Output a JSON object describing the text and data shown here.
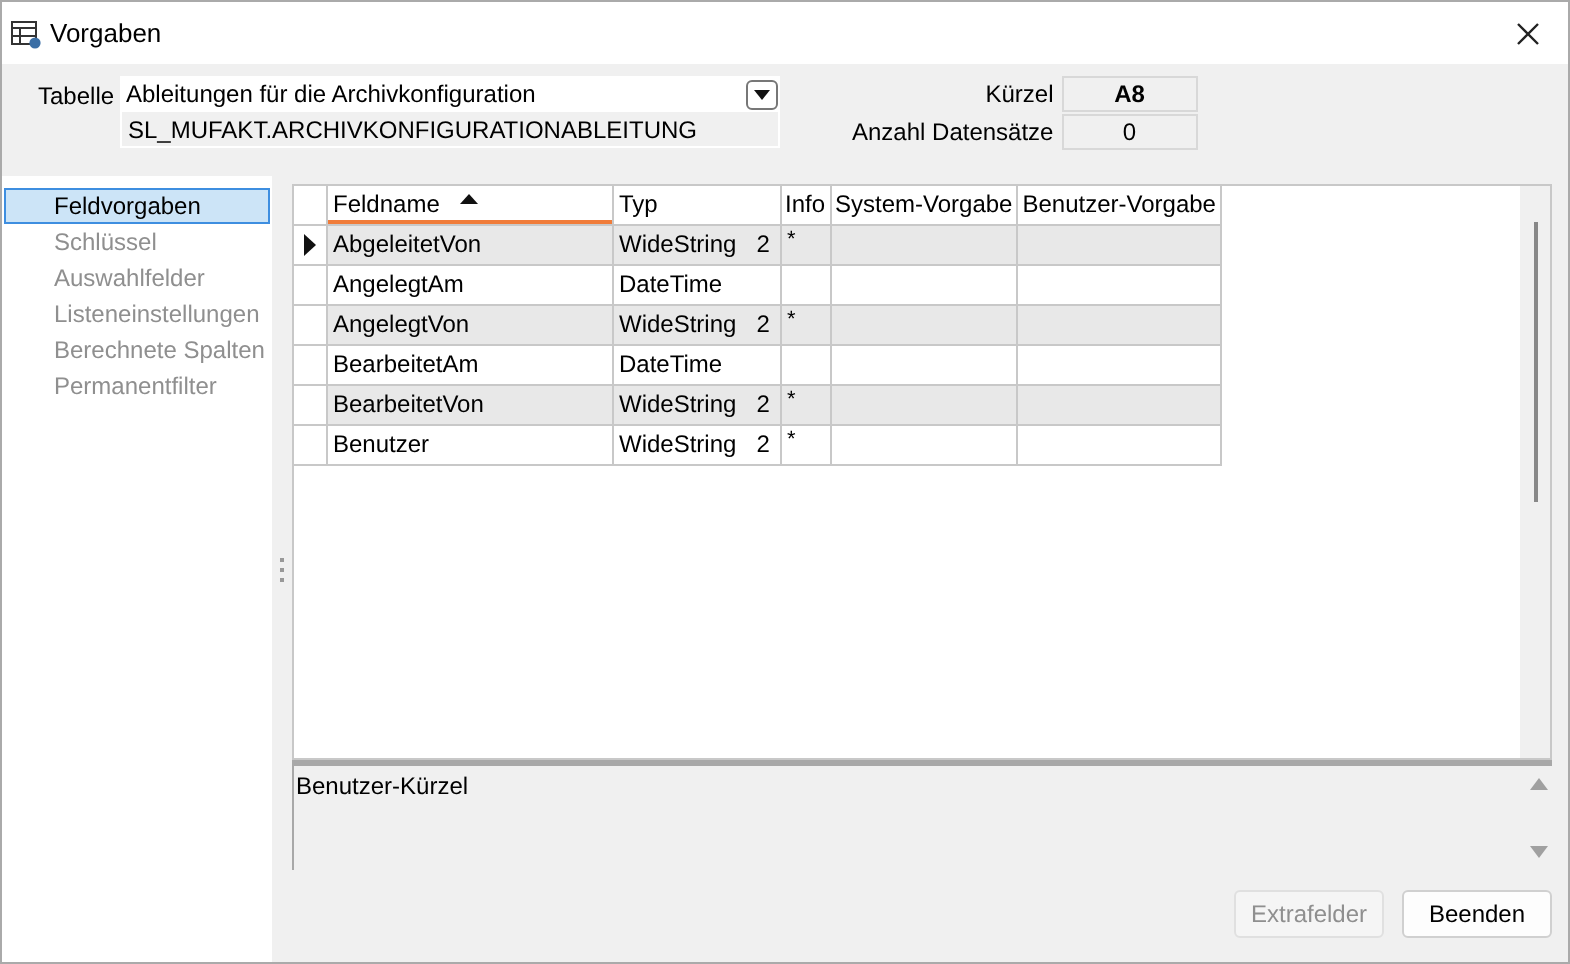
{
  "window": {
    "title": "Vorgaben"
  },
  "tabelle": {
    "label": "Tabelle",
    "value": "Ableitungen für die Archivkonfiguration",
    "internal_name": "SL_MUFAKT.ARCHIVKONFIGURATIONABLEITUNG"
  },
  "info_fields": [
    {
      "label": "Kürzel",
      "value": "A8",
      "bold": true
    },
    {
      "label": "Anzahl Datensätze",
      "value": "0",
      "bold": false
    }
  ],
  "sidebar": {
    "items": [
      {
        "label": "Feldvorgaben",
        "selected": true,
        "disabled": false
      },
      {
        "label": "Schlüssel",
        "selected": false,
        "disabled": true
      },
      {
        "label": "Auswahlfelder",
        "selected": false,
        "disabled": true
      },
      {
        "label": "Listeneinstellungen",
        "selected": false,
        "disabled": true
      },
      {
        "label": "Berechnete Spalten",
        "selected": false,
        "disabled": true
      },
      {
        "label": "Permanentfilter",
        "selected": false,
        "disabled": true
      }
    ]
  },
  "table": {
    "columns": [
      {
        "label": "Feldname",
        "sorted": true
      },
      {
        "label": "Typ",
        "sorted": false
      },
      {
        "label": "Info",
        "sorted": false
      },
      {
        "label": "System-Vorgabe",
        "sorted": false
      },
      {
        "label": "Benutzer-Vorgabe",
        "sorted": false
      }
    ],
    "rows": [
      {
        "current": true,
        "feldname": "AbgeleitetVon",
        "typ": "WideString",
        "length": "2",
        "info": "*"
      },
      {
        "current": false,
        "feldname": "AngelegtAm",
        "typ": "DateTime"
      },
      {
        "current": false,
        "feldname": "AngelegtVon",
        "typ": "WideString",
        "length": "2",
        "info": "*"
      },
      {
        "current": false,
        "feldname": "BearbeitetAm",
        "typ": "DateTime"
      },
      {
        "current": false,
        "feldname": "BearbeitetVon",
        "typ": "WideString",
        "length": "2",
        "info": "*"
      },
      {
        "current": false,
        "feldname": "Benutzer",
        "typ": "WideString",
        "length": "2",
        "info": "*"
      }
    ]
  },
  "description": "Benutzer-Kürzel",
  "buttons": [
    {
      "label": "Extrafelder",
      "disabled": true
    },
    {
      "label": "Beenden",
      "disabled": false
    }
  ]
}
